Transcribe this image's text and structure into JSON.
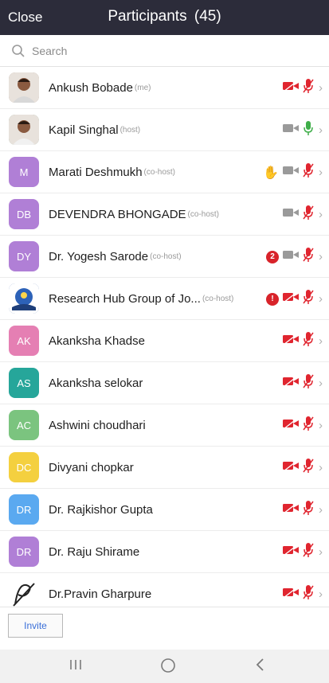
{
  "header": {
    "close_label": "Close",
    "title": "Participants",
    "count": "(45)",
    "bg": "#2c2c3a"
  },
  "search": {
    "placeholder": "Search"
  },
  "participants": [
    {
      "name": "Ankush Bobade",
      "role": "(me)",
      "initials": "",
      "avatar_color": "#9a7a6a",
      "photo": true,
      "video": "off",
      "mic": "off",
      "raise_hand": false,
      "badge": ""
    },
    {
      "name": "Kapil Singhal",
      "role": "(host)",
      "initials": "",
      "avatar_color": "#6b8a6b",
      "photo": true,
      "video": "gray",
      "mic": "on",
      "raise_hand": false,
      "badge": ""
    },
    {
      "name": "Marati  Deshmukh",
      "role": "(co-host)",
      "initials": "M",
      "avatar_color": "#b07fd6",
      "photo": false,
      "video": "gray",
      "mic": "off",
      "raise_hand": true,
      "badge": ""
    },
    {
      "name": "DEVENDRA BHONGADE",
      "role": "(co-host)",
      "initials": "DB",
      "avatar_color": "#b07fd6",
      "photo": false,
      "video": "gray",
      "mic": "off",
      "raise_hand": false,
      "badge": ""
    },
    {
      "name": "Dr. Yogesh Sarode",
      "role": "(co-host)",
      "initials": "DY",
      "avatar_color": "#b07fd6",
      "photo": false,
      "video": "gray",
      "mic": "off",
      "raise_hand": false,
      "badge": "2"
    },
    {
      "name": "Research Hub Group of Jo...",
      "role": "(co-host)",
      "initials": "",
      "avatar_color": "#1f4e9a",
      "photo": true,
      "video": "off",
      "mic": "off",
      "raise_hand": false,
      "badge": "!"
    },
    {
      "name": "Akanksha Khadse",
      "role": "",
      "initials": "AK",
      "avatar_color": "#e57fb3",
      "photo": false,
      "video": "off",
      "mic": "off",
      "raise_hand": false,
      "badge": ""
    },
    {
      "name": "Akanksha selokar",
      "role": "",
      "initials": "AS",
      "avatar_color": "#26a69a",
      "photo": false,
      "video": "off",
      "mic": "off",
      "raise_hand": false,
      "badge": ""
    },
    {
      "name": "Ashwini choudhari",
      "role": "",
      "initials": "AC",
      "avatar_color": "#7bc47f",
      "photo": false,
      "video": "off",
      "mic": "off",
      "raise_hand": false,
      "badge": ""
    },
    {
      "name": "Divyani chopkar",
      "role": "",
      "initials": "DC",
      "avatar_color": "#f4d03f",
      "photo": false,
      "video": "off",
      "mic": "off",
      "raise_hand": false,
      "badge": ""
    },
    {
      "name": "Dr. Rajkishor Gupta",
      "role": "",
      "initials": "DR",
      "avatar_color": "#5aa9f0",
      "photo": false,
      "video": "off",
      "mic": "off",
      "raise_hand": false,
      "badge": ""
    },
    {
      "name": "Dr. Raju Shirame",
      "role": "",
      "initials": "DR",
      "avatar_color": "#b07fd6",
      "photo": false,
      "video": "off",
      "mic": "off",
      "raise_hand": false,
      "badge": ""
    },
    {
      "name": "Dr.Pravin Gharpure",
      "role": "",
      "initials": "",
      "avatar_color": "#ffffff",
      "photo": true,
      "video": "off",
      "mic": "off",
      "raise_hand": false,
      "badge": ""
    }
  ],
  "footer": {
    "invite_label": "Invite"
  },
  "colors": {
    "muted_red": "#e0252f",
    "mic_on_green": "#3fae49",
    "video_gray": "#9a9a9a"
  }
}
